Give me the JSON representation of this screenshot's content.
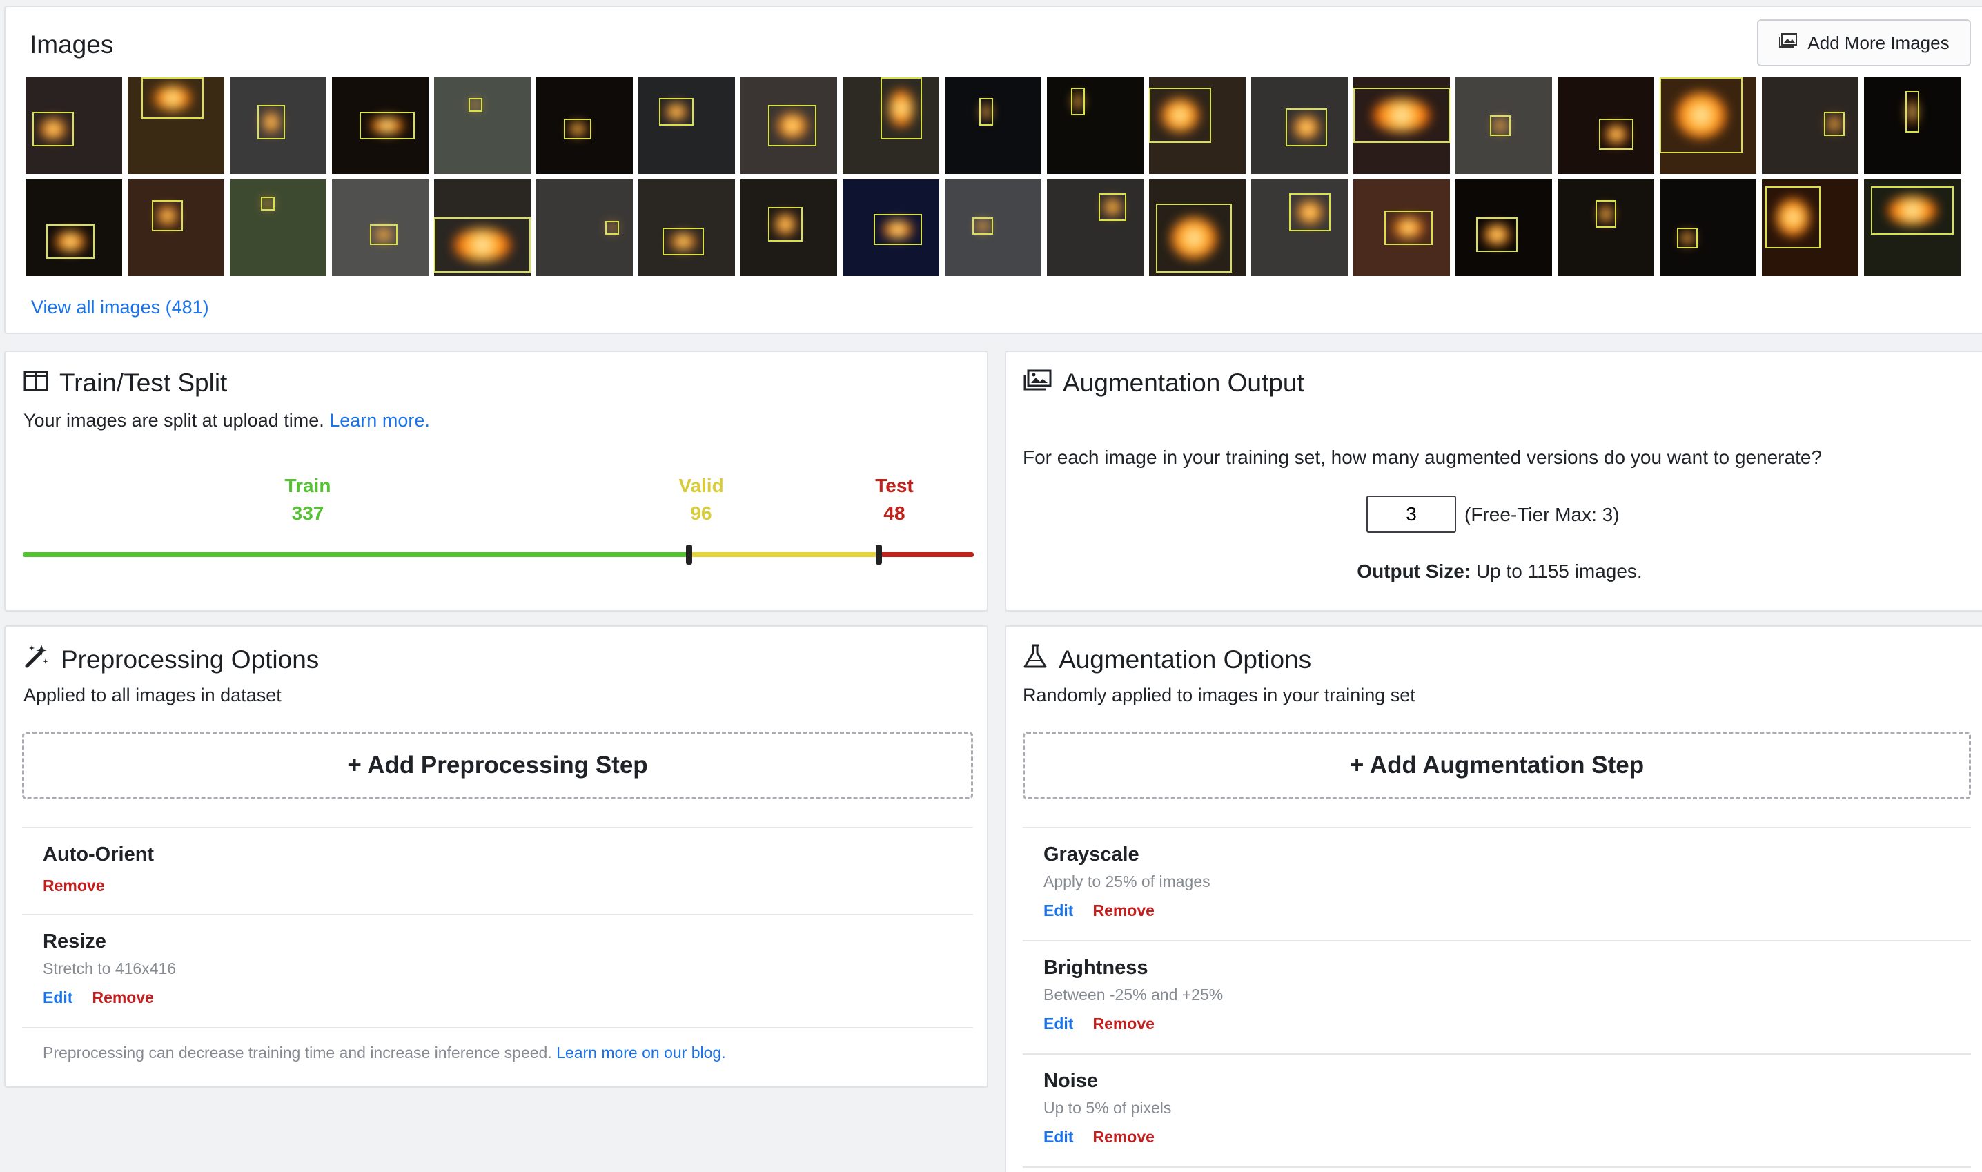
{
  "images": {
    "title": "Images",
    "add_more_label": "Add More Images",
    "view_all_label": "View all images (481)"
  },
  "split": {
    "title": "Train/Test Split",
    "subtitle": "Your images are split at upload time.",
    "learn_more": "Learn more.",
    "train_label": "Train",
    "train_count": "337",
    "valid_label": "Valid",
    "valid_count": "96",
    "test_label": "Test",
    "test_count": "48",
    "colors": {
      "train": "#55c234",
      "valid": "#e3d53b",
      "test": "#c0231c"
    }
  },
  "aug_output": {
    "title": "Augmentation Output",
    "question": "For each image in your training set, how many augmented versions do you want to generate?",
    "value": "3",
    "hint": "(Free-Tier Max: 3)",
    "size_label": "Output Size:",
    "size_value": "Up to 1155 images."
  },
  "preprocessing": {
    "title": "Preprocessing Options",
    "subtitle": "Applied to all images in dataset",
    "add_label": "+ Add Preprocessing Step",
    "steps": [
      {
        "name": "Auto-Orient",
        "remove": "Remove"
      },
      {
        "name": "Resize",
        "desc": "Stretch to 416x416",
        "edit": "Edit",
        "remove": "Remove"
      }
    ],
    "note": "Preprocessing can decrease training time and increase inference speed.",
    "note_link": "Learn more on our blog."
  },
  "augmentation": {
    "title": "Augmentation Options",
    "subtitle": "Randomly applied to images in your training set",
    "add_label": "+ Add Augmentation Step",
    "steps": [
      {
        "name": "Grayscale",
        "desc": "Apply to 25% of images",
        "edit": "Edit",
        "remove": "Remove"
      },
      {
        "name": "Brightness",
        "desc": "Between -25% and +25%",
        "edit": "Edit",
        "remove": "Remove"
      },
      {
        "name": "Noise",
        "desc": "Up to 5% of pixels",
        "edit": "Edit",
        "remove": "Remove"
      }
    ]
  }
}
